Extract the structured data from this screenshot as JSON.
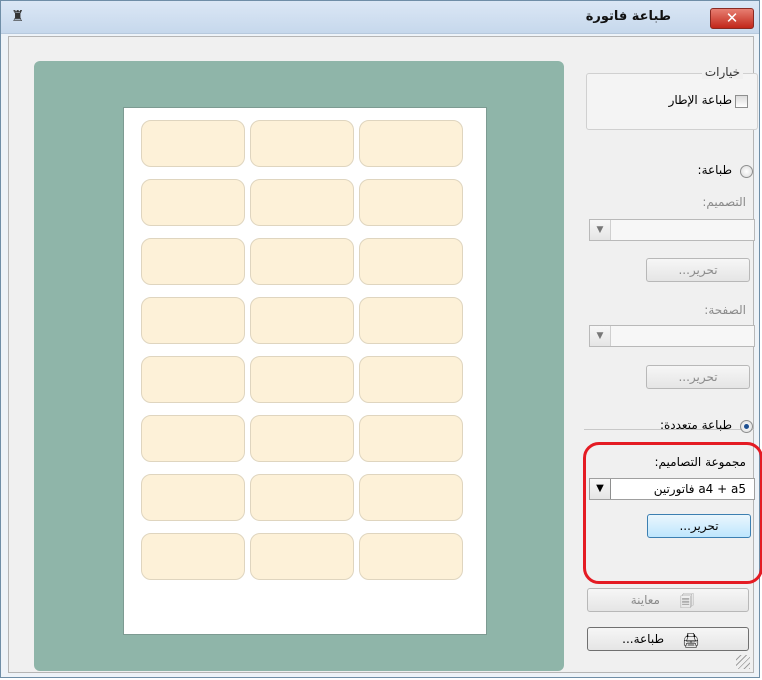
{
  "window": {
    "title": "طباعة فاتورة",
    "close_glyph": "✕",
    "app_icon": "pencil-cup-icon"
  },
  "options": {
    "group_title": "خيارات",
    "print_frame_label": "طباعة الإطار",
    "print_frame_checked": false
  },
  "print_single": {
    "radio_label": "طباعة:",
    "selected": false,
    "design_label": "التصميم:",
    "design_value": "",
    "edit_button": "تحرير...",
    "page_label": "الصفحة:",
    "page_value": "",
    "edit_page_button": "تحرير..."
  },
  "multi_print": {
    "radio_label": "طباعة متعددة:",
    "selected": true,
    "group_label": "مجموعة التصاميم:",
    "group_value": "فاتورتين a4 + a5",
    "edit_button": "تحرير..."
  },
  "actions": {
    "preview_button": "معاينة",
    "print_button": "طباعة..."
  },
  "preview": {
    "rows": 8,
    "columns": 3,
    "highlight_color": "#e41b23",
    "preview_bg": "#8fb5a9",
    "label_color": "#fdf1d8"
  }
}
